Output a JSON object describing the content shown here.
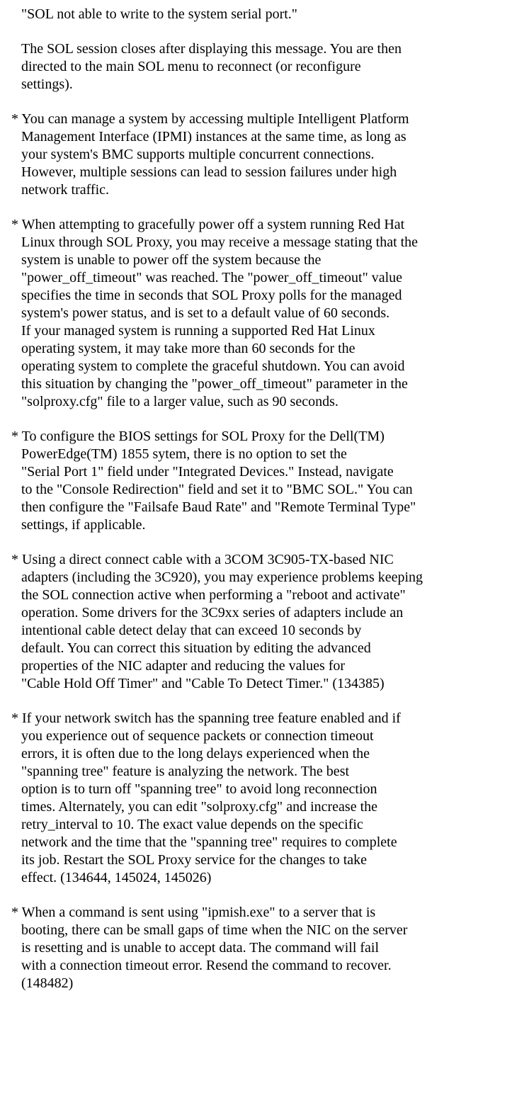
{
  "paragraphs": [
    {
      "lines": [
        "\"SOL not able to write to the system serial port.\""
      ],
      "indent": true,
      "bullet": false
    },
    {
      "lines": [
        "The SOL session closes after displaying this message. You are then",
        "directed to the main SOL menu to reconnect (or reconfigure",
        "settings)."
      ],
      "indent": true,
      "bullet": false
    },
    {
      "lines": [
        "You can manage a system by accessing multiple Intelligent Platform",
        "Management Interface (IPMI) instances at the same time, as long as",
        "your system's BMC supports multiple concurrent connections.",
        "However, multiple sessions can lead to session failures under high",
        "network traffic."
      ],
      "indent": false,
      "bullet": true
    },
    {
      "lines": [
        "When attempting to gracefully power off a system running Red Hat",
        "Linux through SOL Proxy, you may receive a message stating that the",
        "system is unable to power off the system because the",
        "\"power_off_timeout\" was reached. The \"power_off_timeout\" value",
        "specifies the time in seconds that SOL Proxy polls for the managed",
        "system's power status, and is set to a default value of 60 seconds.",
        "If your managed system is running a supported Red Hat Linux",
        "operating system, it may take more than 60 seconds for the",
        "operating system to complete the graceful shutdown. You can avoid",
        "this situation by changing the \"power_off_timeout\" parameter in the",
        "\"solproxy.cfg\" file to a larger value, such as 90 seconds."
      ],
      "indent": false,
      "bullet": true
    },
    {
      "lines": [
        "To configure the BIOS settings for SOL Proxy for the Dell(TM)",
        "PowerEdge(TM) 1855 sytem, there is no option to set the",
        "\"Serial Port 1\" field under \"Integrated Devices.\" Instead, navigate",
        "to the \"Console Redirection\" field and set it to \"BMC SOL.\" You can",
        "then configure the \"Failsafe Baud Rate\" and \"Remote Terminal Type\"",
        "settings, if applicable."
      ],
      "indent": false,
      "bullet": true
    },
    {
      "lines": [
        "Using a direct connect cable with a 3COM 3C905-TX-based NIC",
        "adapters (including the 3C920), you may experience problems keeping",
        "the SOL connection active when performing a \"reboot and activate\"",
        "operation. Some drivers for the 3C9xx series of adapters include an",
        "intentional cable detect delay that can exceed 10 seconds by",
        "default. You can correct this situation by editing the advanced",
        "properties of the NIC adapter and reducing the values for",
        "\"Cable Hold Off Timer\" and \"Cable To Detect Timer.\" (134385)"
      ],
      "indent": false,
      "bullet": true
    },
    {
      "lines": [
        "If your network switch has the spanning tree feature enabled and if",
        "you experience out of sequence packets or connection timeout",
        "errors, it is often due to the long delays experienced when the",
        "\"spanning tree\" feature is analyzing the network. The best",
        "option is to turn off \"spanning tree\" to avoid long reconnection",
        "times. Alternately, you can edit \"solproxy.cfg\" and increase the",
        "retry_interval to 10. The exact value depends on the specific",
        "network and the time that the \"spanning tree\" requires to complete",
        "its job. Restart the SOL Proxy service for the changes to take",
        "effect. (134644, 145024, 145026)"
      ],
      "indent": false,
      "bullet": true
    },
    {
      "lines": [
        "When a command is sent using \"ipmish.exe\" to a server that is",
        "booting, there can be small gaps of time when the NIC on the server",
        "is resetting and is unable to accept data. The command will fail",
        "with a connection timeout error. Resend the command to recover.",
        "(148482)"
      ],
      "indent": false,
      "bullet": true
    }
  ]
}
